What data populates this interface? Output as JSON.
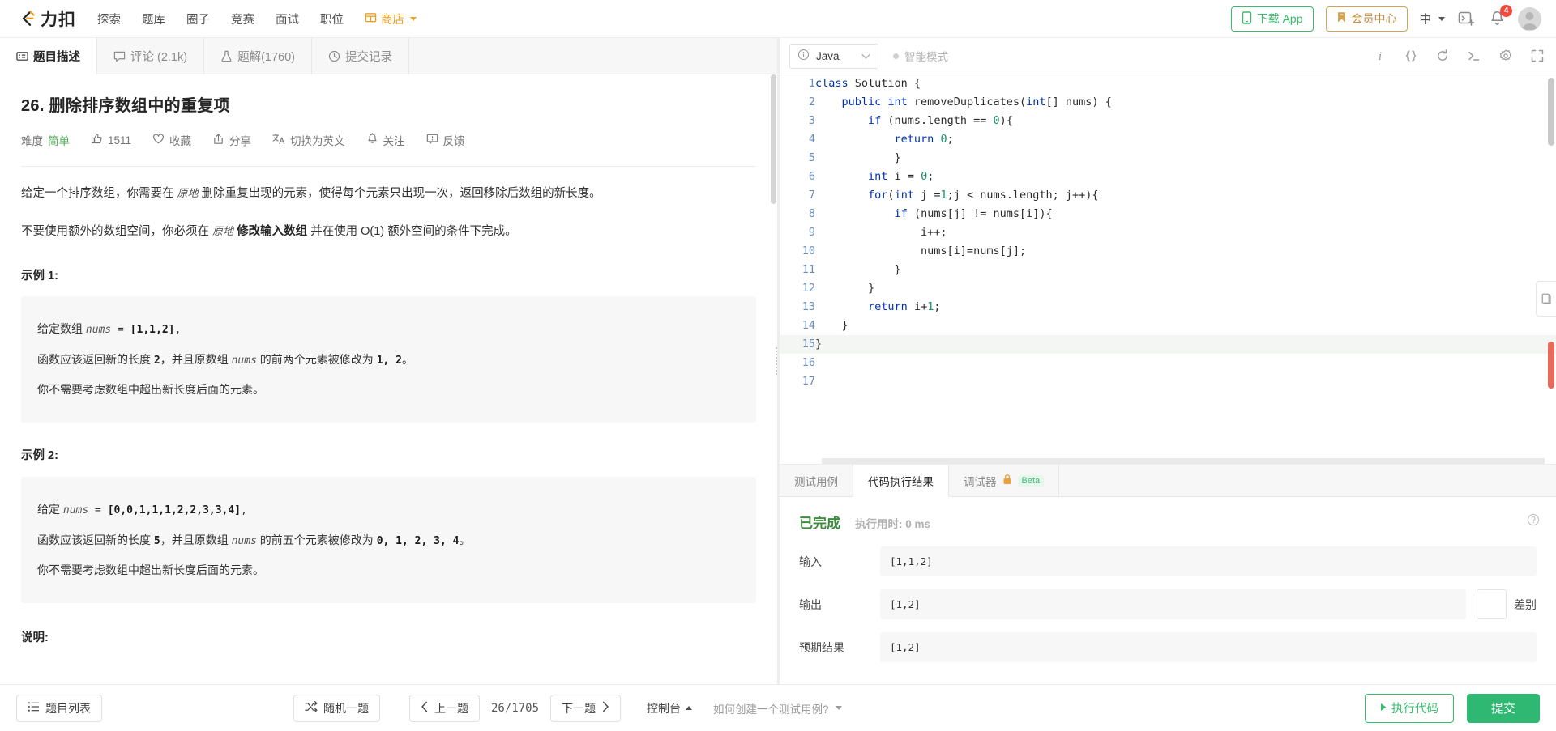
{
  "header": {
    "logo_text": "力扣",
    "nav": [
      {
        "label": "探索",
        "name": "nav-explore"
      },
      {
        "label": "题库",
        "name": "nav-problems"
      },
      {
        "label": "圈子",
        "name": "nav-circle"
      },
      {
        "label": "竞赛",
        "name": "nav-contest"
      },
      {
        "label": "面试",
        "name": "nav-interview"
      },
      {
        "label": "职位",
        "name": "nav-jobs"
      },
      {
        "label": "商店",
        "name": "nav-store"
      }
    ],
    "download_app": "下载 App",
    "member_center": "会员中心",
    "language": "中",
    "notification_count": "4",
    "accent_green": "#37bd6c",
    "accent_gold": "#d4a353",
    "badge_red": "#f5483b"
  },
  "left_tabs": [
    {
      "label": "题目描述",
      "icon": "description-icon",
      "active": true
    },
    {
      "label": "评论 (2.1k)",
      "icon": "comment-icon",
      "active": false
    },
    {
      "label": "题解(1760)",
      "icon": "flask-icon",
      "active": false
    },
    {
      "label": "提交记录",
      "icon": "clock-icon",
      "active": false
    }
  ],
  "problem": {
    "title": "26. 删除排序数组中的重复项",
    "meta": {
      "difficulty_label": "难度",
      "difficulty_value": "简单",
      "likes": "1511",
      "favorite": "收藏",
      "share": "分享",
      "switch_english": "切换为英文",
      "follow": "关注",
      "feedback": "反馈"
    },
    "desc_p1_a": "给定一个排序数组，你需要在 ",
    "desc_p1_inplace": "原地",
    "desc_p1_b": " 删除重复出现的元素，使得每个元素只出现一次，返回移除后数组的新长度。",
    "desc_p2_a": "不要使用额外的数组空间，你必须在 ",
    "desc_p2_inplace": "原地",
    "desc_p2_b": " ",
    "desc_p2_bold": "修改输入数组",
    "desc_p2_c": " 并在使用 O(1) 额外空间的条件下完成。",
    "example1": {
      "title": "示例 1:",
      "l1_a": "给定数组 ",
      "l1_var": "nums",
      "l1_b": " = ",
      "l1_val": "[1,1,2]",
      "l1_c": ",",
      "l2_a": "函数应该返回新的长度 ",
      "l2_len": "2",
      "l2_b": "，并且原数组 ",
      "l2_var": "nums",
      "l2_c": " 的前两个元素被修改为 ",
      "l2_vals": "1, 2",
      "l2_d": "。",
      "l3": "你不需要考虑数组中超出新长度后面的元素。"
    },
    "example2": {
      "title": "示例 2:",
      "l1_a": "给定 ",
      "l1_var": "nums",
      "l1_b": " = ",
      "l1_val": "[0,0,1,1,1,2,2,3,3,4]",
      "l1_c": ",",
      "l2_a": "函数应该返回新的长度 ",
      "l2_len": "5",
      "l2_b": "，并且原数组 ",
      "l2_var": "nums",
      "l2_c": " 的前五个元素被修改为 ",
      "l2_vals": "0, 1, 2, 3, 4",
      "l2_d": "。",
      "l3": "你不需要考虑数组中超出新长度后面的元素。"
    },
    "note_title": "说明:"
  },
  "editor": {
    "language": "Java",
    "smart_mode": "智能模式",
    "tools": [
      {
        "name": "info-icon",
        "glyph": "i"
      },
      {
        "name": "format-braces-icon",
        "glyph": "{}"
      },
      {
        "name": "reset-icon",
        "glyph": "↻"
      },
      {
        "name": "terminal-icon",
        "glyph": "❯_"
      },
      {
        "name": "settings-icon",
        "glyph": "⚙"
      },
      {
        "name": "fullscreen-icon",
        "glyph": "⛶"
      }
    ],
    "code_lines": [
      {
        "n": "1",
        "tokens": [
          {
            "t": "class ",
            "c": "kw"
          },
          {
            "t": "Solution {",
            "c": ""
          }
        ]
      },
      {
        "n": "2",
        "tokens": [
          {
            "t": "    ",
            "c": ""
          },
          {
            "t": "public int ",
            "c": "kw"
          },
          {
            "t": "removeDuplicates(",
            "c": ""
          },
          {
            "t": "int",
            "c": "kw"
          },
          {
            "t": "[] nums) {",
            "c": ""
          }
        ]
      },
      {
        "n": "3",
        "tokens": [
          {
            "t": "        ",
            "c": ""
          },
          {
            "t": "if ",
            "c": "kw"
          },
          {
            "t": "(nums.length == ",
            "c": ""
          },
          {
            "t": "0",
            "c": "num"
          },
          {
            "t": "){",
            "c": ""
          }
        ]
      },
      {
        "n": "4",
        "tokens": [
          {
            "t": "            ",
            "c": ""
          },
          {
            "t": "return ",
            "c": "kw"
          },
          {
            "t": "0",
            "c": "num"
          },
          {
            "t": ";",
            "c": ""
          }
        ]
      },
      {
        "n": "5",
        "tokens": [
          {
            "t": "            }",
            "c": ""
          }
        ]
      },
      {
        "n": "6",
        "tokens": [
          {
            "t": "        ",
            "c": ""
          },
          {
            "t": "int",
            "c": "kw"
          },
          {
            "t": " i = ",
            "c": ""
          },
          {
            "t": "0",
            "c": "num"
          },
          {
            "t": ";",
            "c": ""
          }
        ]
      },
      {
        "n": "7",
        "tokens": [
          {
            "t": "        ",
            "c": ""
          },
          {
            "t": "for",
            "c": "kw"
          },
          {
            "t": "(",
            "c": ""
          },
          {
            "t": "int",
            "c": "kw"
          },
          {
            "t": " j =",
            "c": ""
          },
          {
            "t": "1",
            "c": "num"
          },
          {
            "t": ";j < nums.length; j++){",
            "c": ""
          }
        ]
      },
      {
        "n": "8",
        "tokens": [
          {
            "t": "            ",
            "c": ""
          },
          {
            "t": "if ",
            "c": "kw"
          },
          {
            "t": "(nums[j] != nums[i]){",
            "c": ""
          }
        ]
      },
      {
        "n": "9",
        "tokens": [
          {
            "t": "                i++;",
            "c": ""
          }
        ]
      },
      {
        "n": "10",
        "tokens": [
          {
            "t": "                nums[i]=nums[j];",
            "c": ""
          }
        ]
      },
      {
        "n": "11",
        "tokens": [
          {
            "t": "            }",
            "c": ""
          }
        ]
      },
      {
        "n": "12",
        "tokens": [
          {
            "t": "        }",
            "c": ""
          }
        ]
      },
      {
        "n": "13",
        "tokens": [
          {
            "t": "        ",
            "c": ""
          },
          {
            "t": "return ",
            "c": "kw"
          },
          {
            "t": "i+",
            "c": ""
          },
          {
            "t": "1",
            "c": "num"
          },
          {
            "t": ";",
            "c": ""
          }
        ]
      },
      {
        "n": "14",
        "tokens": [
          {
            "t": "    }",
            "c": ""
          }
        ]
      },
      {
        "n": "15",
        "tokens": [
          {
            "t": "}",
            "c": ""
          }
        ],
        "current": true
      },
      {
        "n": "16",
        "tokens": [
          {
            "t": "",
            "c": ""
          }
        ]
      },
      {
        "n": "17",
        "tokens": [
          {
            "t": "",
            "c": ""
          }
        ]
      }
    ]
  },
  "result": {
    "tabs": [
      {
        "label": "测试用例",
        "active": false,
        "locked": false,
        "beta": ""
      },
      {
        "label": "代码执行结果",
        "active": true,
        "locked": false,
        "beta": ""
      },
      {
        "label": "调试器",
        "active": false,
        "locked": true,
        "beta": "Beta"
      }
    ],
    "status": "已完成",
    "runtime_label": "执行用时:",
    "runtime_value": "0 ms",
    "fields": [
      {
        "label": "输入",
        "value": "[1,1,2]",
        "has_diff": false,
        "diff_label": ""
      },
      {
        "label": "输出",
        "value": "[1,2]",
        "has_diff": true,
        "diff_label": "差别"
      },
      {
        "label": "预期结果",
        "value": "[1,2]",
        "has_diff": false,
        "diff_label": ""
      }
    ]
  },
  "footer": {
    "problem_list": "题目列表",
    "random_problem": "随机一题",
    "prev_problem": "上一题",
    "page_count": "26/1705",
    "next_problem": "下一题",
    "console": "控制台",
    "hint": "如何创建一个测试用例?",
    "run_code": "执行代码",
    "submit": "提交"
  }
}
